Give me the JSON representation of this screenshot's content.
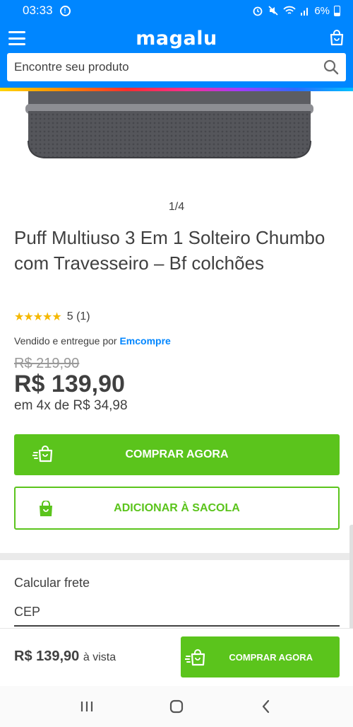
{
  "status_bar": {
    "time": "03:33",
    "battery": "6%"
  },
  "header": {
    "logo": "magalu",
    "search_placeholder": "Encontre seu produto"
  },
  "gallery": {
    "pager": "1/4"
  },
  "product": {
    "title": "Puff Multiuso 3 Em 1 Solteiro Chumbo com Travesseiro – Bf colchões",
    "rating_text": "5 (1)",
    "seller_prefix": "Vendido e entregue por ",
    "seller_name": "Emcompre",
    "old_price": "R$ 219,90",
    "price": "R$ 139,90",
    "installments": "em 4x de R$ 34,98"
  },
  "actions": {
    "buy_now": "COMPRAR AGORA",
    "add_to_bag": "ADICIONAR À SACOLA"
  },
  "shipping": {
    "label": "Calcular frete",
    "cep_placeholder": "CEP"
  },
  "sticky": {
    "price": "R$ 139,90",
    "price_suffix": "à vista",
    "buy_now": "COMPRAR AGORA"
  },
  "colors": {
    "brand_blue": "#0086ff",
    "buy_green": "#5bc41c",
    "rating_yellow": "#f5b800"
  }
}
